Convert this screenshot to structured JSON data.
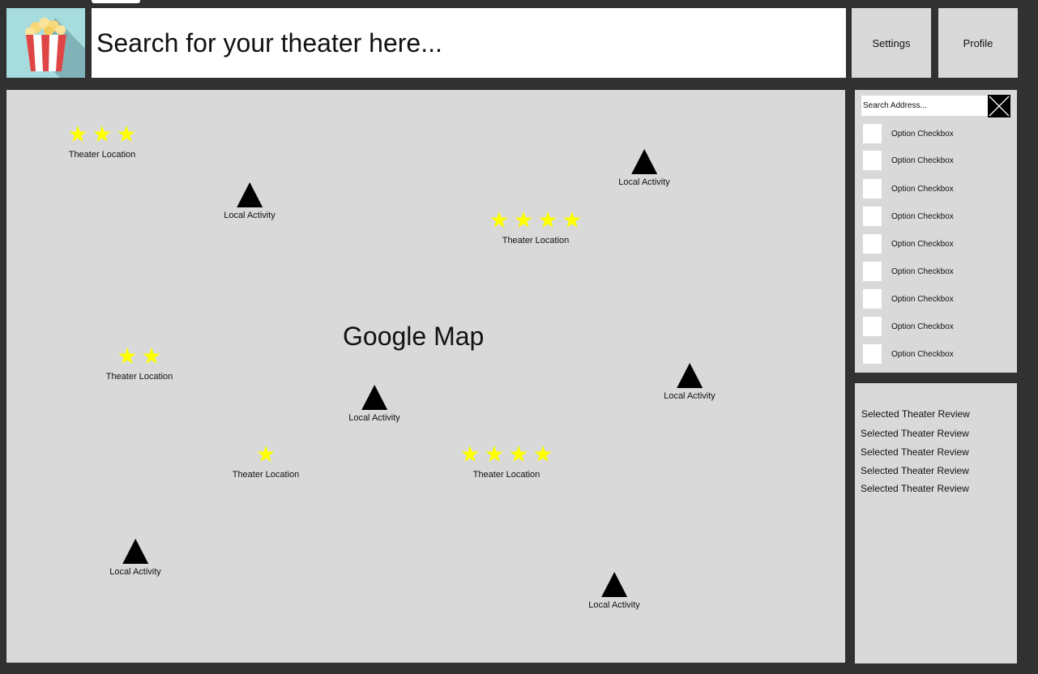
{
  "header": {
    "logo_icon": "popcorn-icon",
    "search_placeholder": "Search for your theater here...",
    "settings_label": "Settings",
    "profile_label": "Profile"
  },
  "map": {
    "title": "Google Map",
    "theaters": [
      {
        "label": "Theater Location",
        "rating": 3
      },
      {
        "label": "Theater Location",
        "rating": 4
      },
      {
        "label": "Theater Location",
        "rating": 2
      },
      {
        "label": "Theater Location",
        "rating": 1
      },
      {
        "label": "Theater Location",
        "rating": 4
      }
    ],
    "activities": [
      {
        "label": "Local Activity"
      },
      {
        "label": "Local Activity"
      },
      {
        "label": "Local Activity"
      },
      {
        "label": "Local Activity"
      },
      {
        "label": "Local Activity"
      },
      {
        "label": "Local Activity"
      }
    ]
  },
  "filters": {
    "address_placeholder": "Search Address...",
    "clear_icon": "close-icon",
    "options": [
      {
        "label": "Option Checkbox",
        "checked": false
      },
      {
        "label": "Option Checkbox",
        "checked": false
      },
      {
        "label": "Option Checkbox",
        "checked": false
      },
      {
        "label": "Option Checkbox",
        "checked": false
      },
      {
        "label": "Option Checkbox",
        "checked": false
      },
      {
        "label": "Option Checkbox",
        "checked": false
      },
      {
        "label": "Option Checkbox",
        "checked": false
      },
      {
        "label": "Option Checkbox",
        "checked": false
      },
      {
        "label": "Option Checkbox",
        "checked": false
      }
    ]
  },
  "reviews": {
    "items": [
      "Selected Theater Review",
      "Selected Theater Review",
      "Selected Theater Review",
      "Selected Theater Review",
      "Selected Theater Review"
    ]
  },
  "colors": {
    "background": "#313131",
    "panel": "#d9d9d9",
    "star": "#ffff00",
    "logo_bg": "#a6dcdd"
  }
}
